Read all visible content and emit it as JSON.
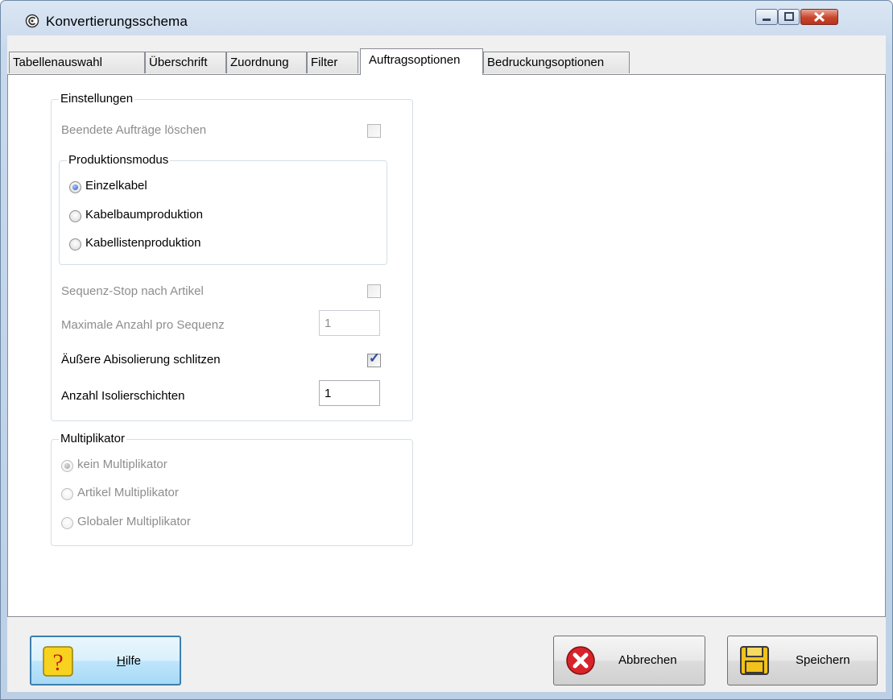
{
  "window": {
    "title": "Konvertierungsschema",
    "app_icon": "app-logo-icon",
    "controls": [
      "minimize-icon",
      "maximize-icon",
      "close-icon"
    ]
  },
  "tabs": [
    {
      "label": "Tabellenauswahl",
      "active": false
    },
    {
      "label": "Überschrift",
      "active": false
    },
    {
      "label": "Zuordnung",
      "active": false
    },
    {
      "label": "Filter",
      "active": false
    },
    {
      "label": "Auftragsoptionen",
      "active": true
    },
    {
      "label": "Bedruckungsoptionen",
      "active": false
    }
  ],
  "einstellungen": {
    "legend": "Einstellungen",
    "beendete_label": "Beendete Aufträge löschen",
    "beendete_checked": false,
    "produktionsmodus": {
      "legend": "Produktionsmodus",
      "options": [
        {
          "label": "Einzelkabel",
          "selected": true
        },
        {
          "label": "Kabelbaumproduktion",
          "selected": false
        },
        {
          "label": "Kabellistenproduktion",
          "selected": false
        }
      ]
    },
    "sequenz_label": "Sequenz-Stop nach Artikel",
    "sequenz_checked": false,
    "max_label": "Maximale Anzahl pro Sequenz",
    "max_value": "1",
    "schlitzen_label": "Äußere Abisolierung schlitzen",
    "schlitzen_checked": true,
    "anzahl_label": "Anzahl Isolierschichten",
    "anzahl_value": "1"
  },
  "multiplikator": {
    "legend": "Multiplikator",
    "options": [
      {
        "label": "kein Multiplikator",
        "selected": true
      },
      {
        "label": "Artikel Multiplikator",
        "selected": false
      },
      {
        "label": "Globaler Multiplikator",
        "selected": false
      }
    ]
  },
  "buttons": {
    "help": {
      "label_underlined": "H",
      "label_rest": "ilfe",
      "icon": "help-question-icon"
    },
    "cancel": {
      "label": "Abbrechen",
      "icon": "cancel-x-icon"
    },
    "save": {
      "label": "Speichern",
      "icon": "save-disk-icon"
    }
  },
  "colors": {
    "cancel_red": "#d8232a",
    "save_yellow": "#f2c21b",
    "help_yellow": "#f7d21e"
  }
}
